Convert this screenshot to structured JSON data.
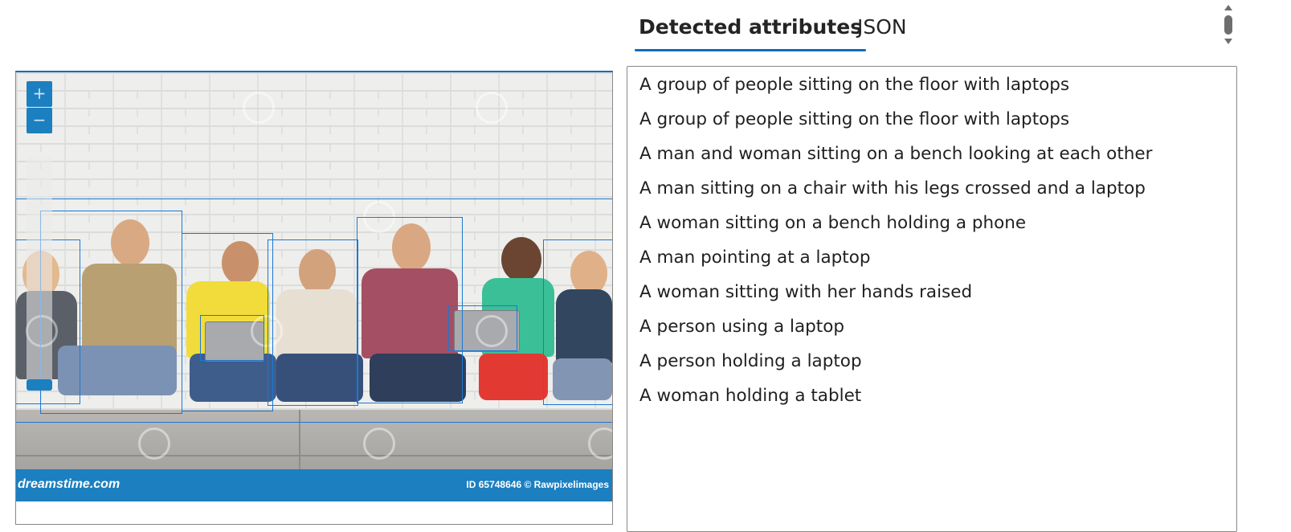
{
  "tabs": [
    {
      "label": "Detected attributes",
      "active": true
    },
    {
      "label": "JSON",
      "active": false
    }
  ],
  "viewer": {
    "zoom_in_symbol": "+",
    "zoom_out_symbol": "−",
    "watermark_logo_text": "dreamstime.com",
    "watermark_id_text": "ID 65748646 © Rawpixelimages"
  },
  "attributes": [
    "A group of people sitting on the floor with laptops",
    "A group of people sitting on the floor with laptops",
    "A man and woman sitting on a bench looking at each other",
    "A man sitting on a chair with his legs crossed and a laptop",
    "A woman sitting on a bench holding a phone",
    "A man pointing at a laptop",
    "A woman sitting with her hands raised",
    "A person using a laptop",
    "A person holding a laptop",
    "A woman holding a tablet"
  ],
  "colors": {
    "accent": "#0f6cbd",
    "bbox": "#1c78d4",
    "banner": "#1c7fc0"
  }
}
